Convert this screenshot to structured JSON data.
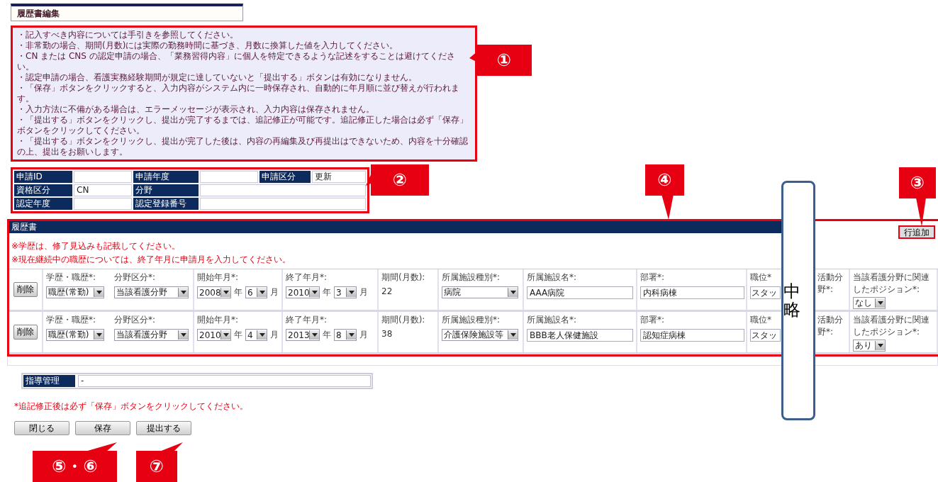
{
  "page_title": "履歴書編集",
  "notices": [
    "・記入すべき内容については手引きを参照してください。",
    "・非常勤の場合、期間(月数)には実際の勤務時間に基づき、月数に換算した値を入力してください。",
    "・CN または CNS の認定申請の場合、「業務習得内容」に個人を特定できるような記述をすることは避けてください。",
    "・認定申請の場合、看護実務経験期間が規定に達していないと「提出する」ボタンは有効になりません。",
    "・「保存」ボタンをクリックすると、入力内容がシステム内に一時保存され、自動的に年月順に並び替えが行われます。",
    "・入力方法に不備がある場合は、エラーメッセージが表示され、入力内容は保存されません。",
    "・「提出する」ボタンをクリックし、提出が完了するまでは、追記修正が可能です。追記修正した場合は必ず「保存」ボタンをクリックしてください。",
    "・「提出する」ボタンをクリックし、提出が完了した後は、内容の再編集及び再提出はできないため、内容を十分確認の上、提出をお願いします。"
  ],
  "application_info": [
    [
      {
        "label": "申請ID"
      },
      {
        "label": "申請年度"
      },
      {
        "label": "申請区分",
        "value": "更新"
      }
    ],
    [
      {
        "label": "資格区分",
        "value": "CN"
      },
      {
        "label": "分野"
      }
    ],
    [
      {
        "label": "認定年度"
      },
      {
        "label": "認定登録番号"
      }
    ]
  ],
  "history": {
    "title": "履歴書",
    "add_button": "行追加",
    "notes": [
      "※学歴は、修了見込みも記載してください。",
      "※現在継続中の職歴については、終了年月に申請月を入力してください。"
    ],
    "rows": [
      {
        "delete_button": "削除",
        "education": {
          "label": "学歴・職歴",
          "mark": "*:",
          "value": "職歴(常勤)"
        },
        "category": {
          "label": "分野区分",
          "mark": "*:",
          "value": "当該看護分野"
        },
        "start": {
          "label": "開始年月",
          "mark": "*:",
          "year": "2008",
          "year_unit": "年",
          "month": "6",
          "month_unit": "月"
        },
        "end": {
          "label": "終了年月",
          "mark": "*:",
          "year": "2010",
          "year_unit": "年",
          "month": "3",
          "month_unit": "月"
        },
        "period": {
          "label": "期間(月数):",
          "value": "22"
        },
        "facility_type": {
          "label": "所属施設種別",
          "mark": "*:",
          "value": "病院"
        },
        "facility_name": {
          "label": "所属施設名",
          "mark": "*:",
          "value": "AAA病院"
        },
        "department": {
          "label": "部署",
          "mark": "*:",
          "value": "内科病棟"
        },
        "position": {
          "label": "職位",
          "mark": "*",
          "value": "スタッ"
        },
        "activity": {
          "label": "活動分野",
          "mark": "*:"
        },
        "role": {
          "label": "当該看護分野に関連したポジション",
          "mark": "*:",
          "value": "なし"
        }
      },
      {
        "delete_button": "削除",
        "education": {
          "label": "学歴・職歴",
          "mark": "*:",
          "value": "職歴(常勤)"
        },
        "category": {
          "label": "分野区分",
          "mark": "*:",
          "value": "当該看護分野"
        },
        "start": {
          "label": "開始年月",
          "mark": "*:",
          "year": "2010",
          "year_unit": "年",
          "month": "4",
          "month_unit": "月"
        },
        "end": {
          "label": "終了年月",
          "mark": "*:",
          "year": "2013",
          "year_unit": "年",
          "month": "8",
          "month_unit": "月"
        },
        "period": {
          "label": "期間(月数):",
          "value": "38"
        },
        "facility_type": {
          "label": "所属施設種別",
          "mark": "*:",
          "value": "介護保険施設等"
        },
        "facility_name": {
          "label": "所属施設名",
          "mark": "*:",
          "value": "BBB老人保健施設"
        },
        "department": {
          "label": "部署",
          "mark": "*:",
          "value": "認知症病棟"
        },
        "position": {
          "label": "職位",
          "mark": "*",
          "value": "スタッ"
        },
        "activity": {
          "label": "活動分野",
          "mark": "*:"
        },
        "role": {
          "label": "当該看護分野に関連したポジション",
          "mark": "*:",
          "value": "あり"
        }
      }
    ]
  },
  "guidance": {
    "label": "指導管理",
    "value": "-"
  },
  "save_note": "*追記修正後は必ず「保存」ボタンをクリックしてください。",
  "buttons": [
    "閉じる",
    "保存",
    "提出する"
  ],
  "omission_banner": "中略",
  "annotations": [
    {
      "label": "①"
    },
    {
      "label": "②"
    },
    {
      "label": "④"
    },
    {
      "label": "③"
    },
    {
      "label": "⑤・⑥"
    },
    {
      "label": "⑦"
    }
  ]
}
